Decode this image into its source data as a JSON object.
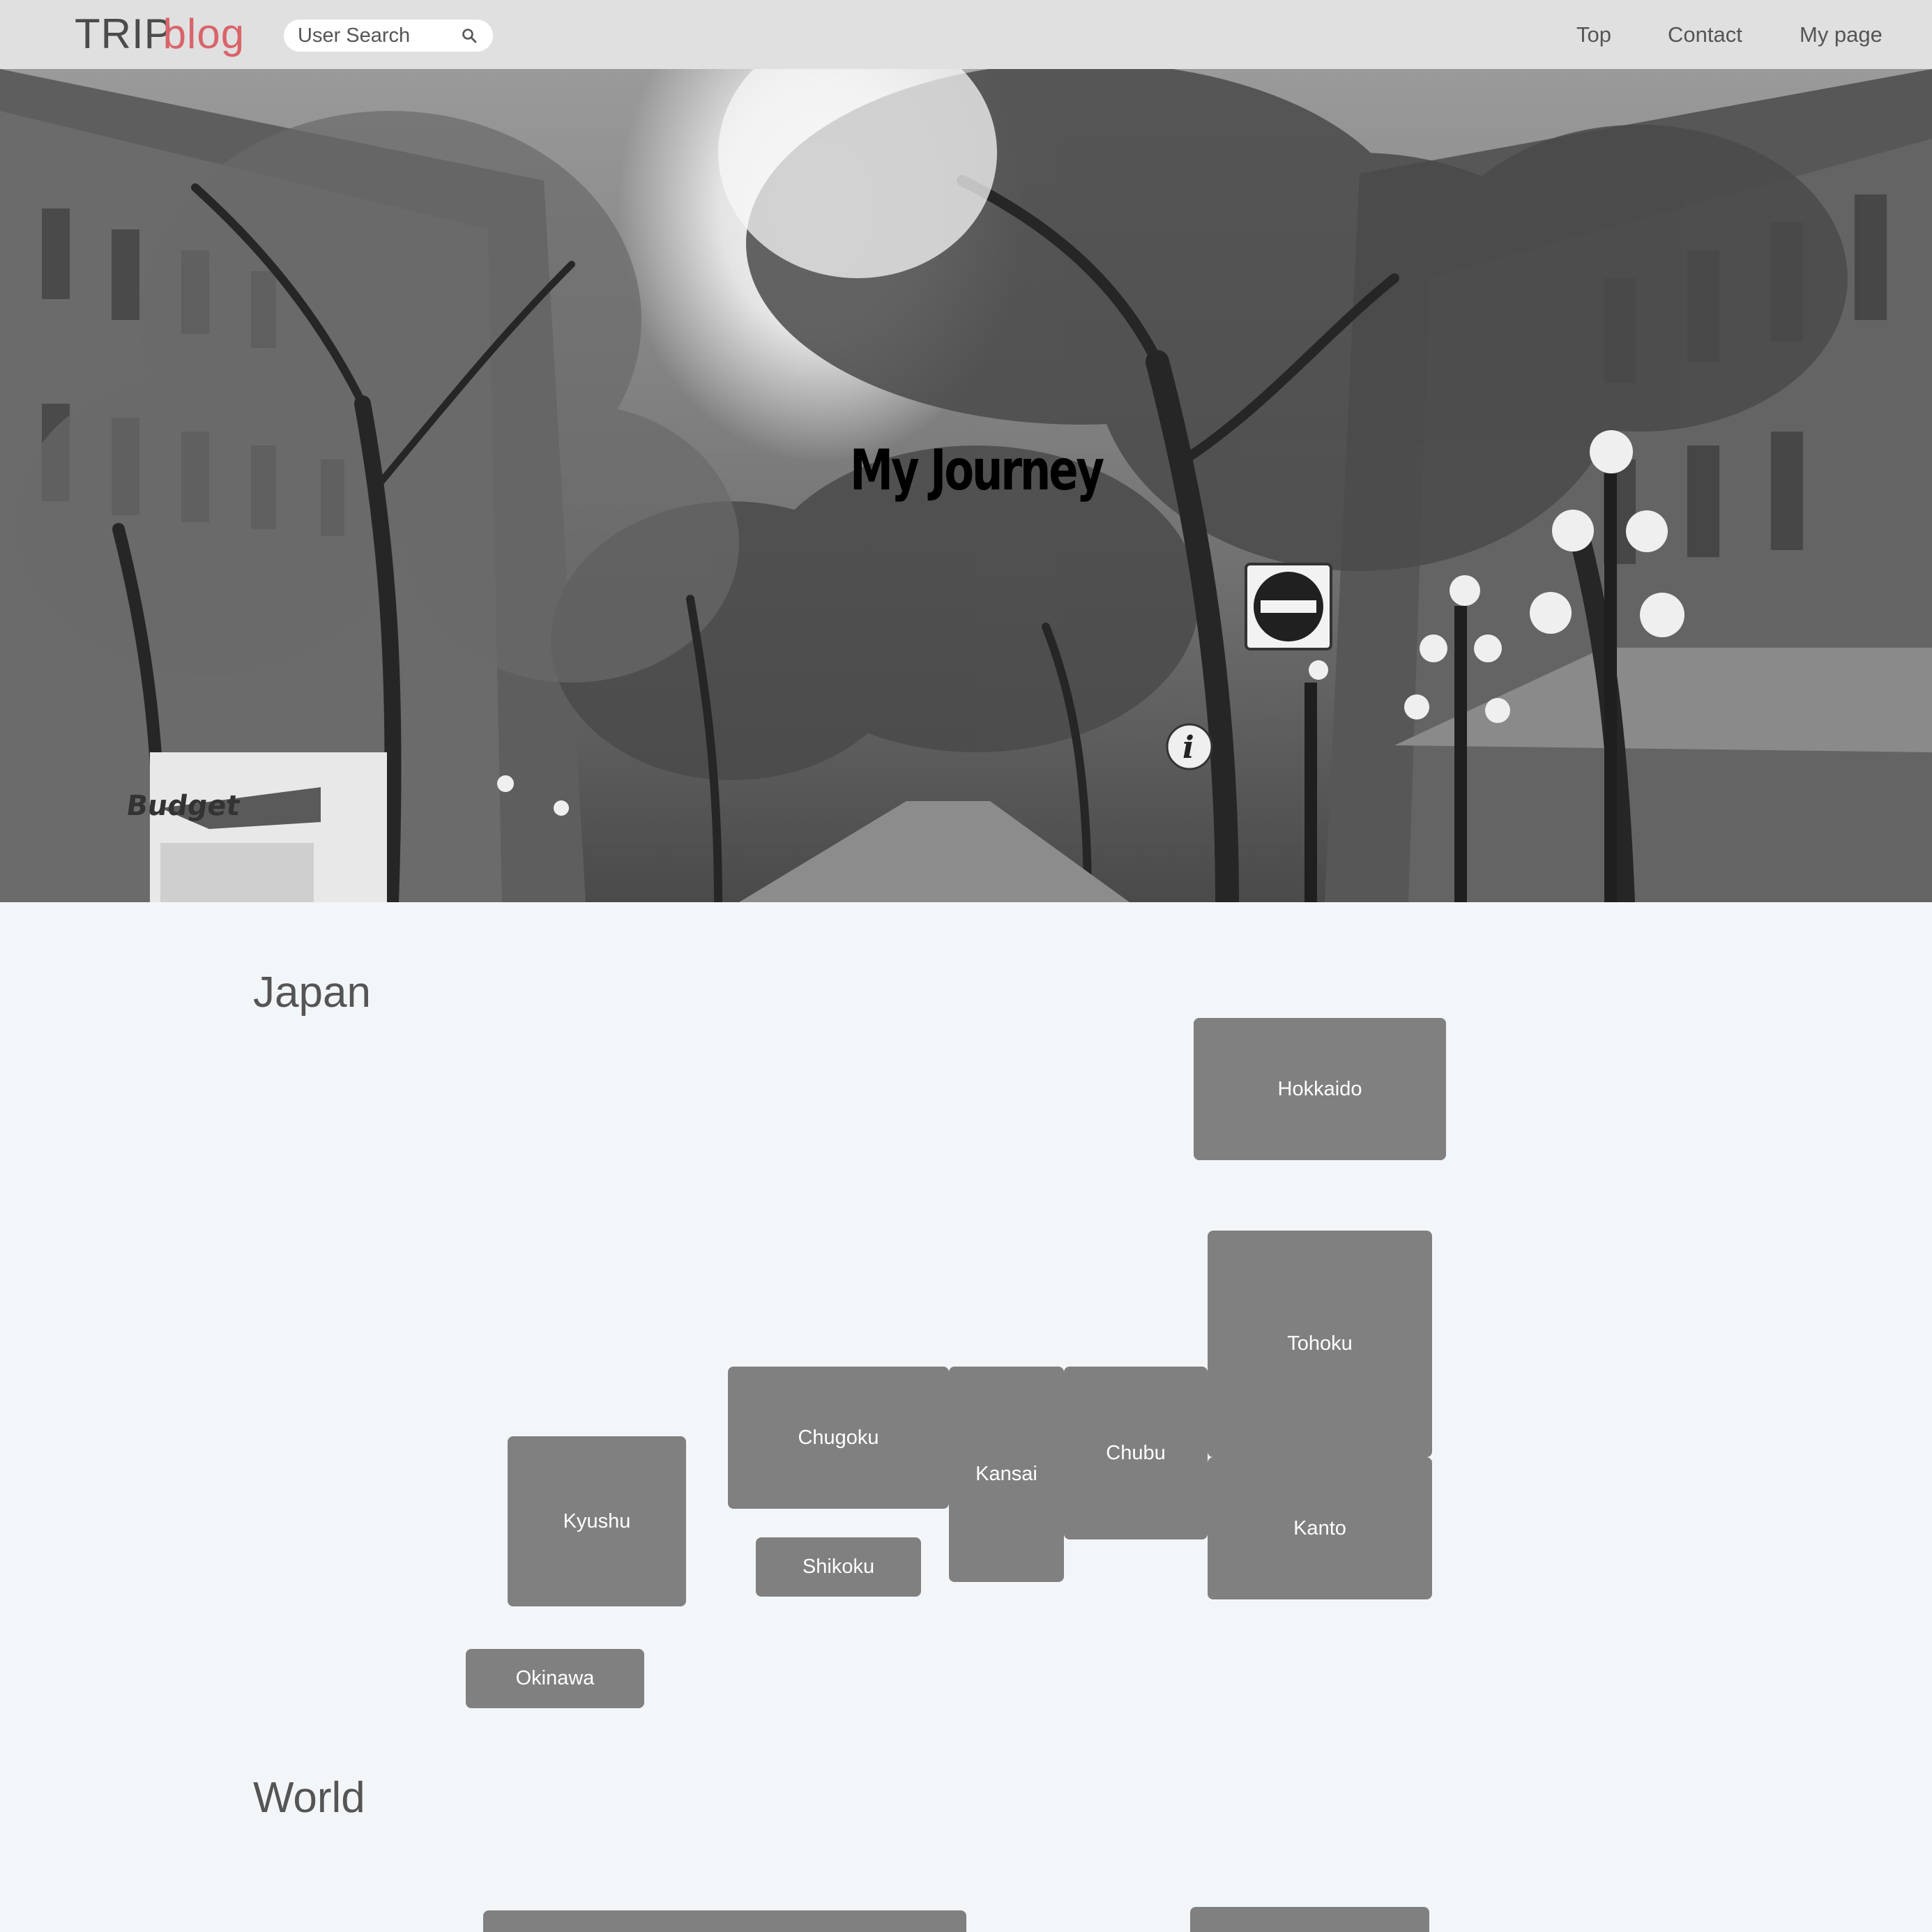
{
  "header": {
    "logo_part1": "TRIP",
    "logo_part2": "blog",
    "search_placeholder": "User Search",
    "search_icon": "search-icon",
    "nav": {
      "top": "Top",
      "contact": "Contact",
      "my_page": "My page"
    }
  },
  "hero": {
    "title": "My Journey",
    "image_style": "grayscale street photo with trees"
  },
  "sections": {
    "japan": {
      "title": "Japan",
      "regions": {
        "hokkaido": "Hokkaido",
        "tohoku": "Tohoku",
        "kanto": "Kanto",
        "chubu": "Chubu",
        "kansai": "Kansai",
        "chugoku": "Chugoku",
        "shikoku": "Shikoku",
        "kyushu": "Kyushu",
        "okinawa": "Okinawa"
      }
    },
    "world": {
      "title": "World"
    }
  },
  "colors": {
    "header_bg": "#e0e0e0",
    "logo_dark": "#4b4b4b",
    "logo_accent": "#d9646a",
    "page_bg": "#f3f6f9",
    "region_tile": "#808080",
    "text_gray": "#555555"
  }
}
